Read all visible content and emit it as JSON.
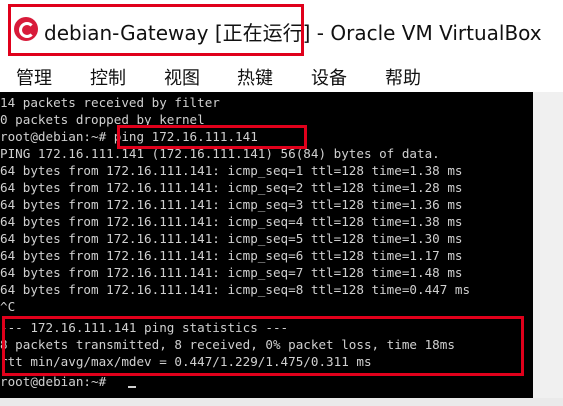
{
  "window": {
    "title": "debian-Gateway [正在运行] - Oracle VM VirtualBox",
    "icon": "virtualbox-debian-swirl-icon"
  },
  "menubar": {
    "items": [
      "管理",
      "控制",
      "视图",
      "热键",
      "设备",
      "帮助"
    ]
  },
  "terminal": {
    "lines": [
      "14 packets received by filter",
      "0 packets dropped by kernel",
      "root@debian:~# ping 172.16.111.141",
      "PING 172.16.111.141 (172.16.111.141) 56(84) bytes of data.",
      "64 bytes from 172.16.111.141: icmp_seq=1 ttl=128 time=1.38 ms",
      "64 bytes from 172.16.111.141: icmp_seq=2 ttl=128 time=1.28 ms",
      "64 bytes from 172.16.111.141: icmp_seq=3 ttl=128 time=1.36 ms",
      "64 bytes from 172.16.111.141: icmp_seq=4 ttl=128 time=1.38 ms",
      "64 bytes from 172.16.111.141: icmp_seq=5 ttl=128 time=1.30 ms",
      "64 bytes from 172.16.111.141: icmp_seq=6 ttl=128 time=1.17 ms",
      "64 bytes from 172.16.111.141: icmp_seq=7 ttl=128 time=1.48 ms",
      "64 bytes from 172.16.111.141: icmp_seq=8 ttl=128 time=0.447 ms",
      "^C",
      "--- 172.16.111.141 ping statistics ---",
      "8 packets transmitted, 8 received, 0% packet loss, time 18ms",
      "rtt min/avg/max/mdev = 0.447/1.229/1.475/0.311 ms",
      "root@debian:~# "
    ]
  },
  "colors": {
    "annotation": "#e0001b",
    "terminal_bg": "#000000",
    "terminal_fg": "#d0d0d0"
  }
}
